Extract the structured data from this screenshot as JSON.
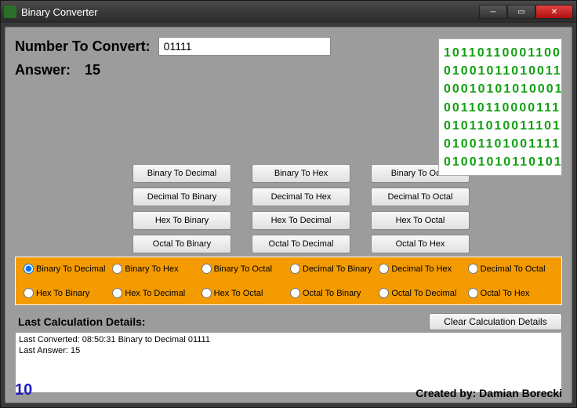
{
  "window": {
    "title": "Binary Converter"
  },
  "input": {
    "label": "Number To Convert:",
    "value": "01111"
  },
  "answer": {
    "label": "Answer:",
    "value": "15"
  },
  "buttons": [
    "Binary To Decimal",
    "Binary To Hex",
    "Binary To Octal",
    "Decimal To Binary",
    "Decimal To Hex",
    "Decimal To Octal",
    "Hex To Binary",
    "Hex To Decimal",
    "Hex To Octal",
    "Octal To Binary",
    "Octal To Decimal",
    "Octal To Hex"
  ],
  "radios": [
    "Binary To Decimal",
    "Binary To Hex",
    "Binary To Octal",
    "Decimal To Binary",
    "Decimal To Hex",
    "Decimal To Octal",
    "Hex To Binary",
    "Hex To Decimal",
    "Hex To Octal",
    "Octal To Binary",
    "Octal To Decimal",
    "Octal To Hex"
  ],
  "radio_selected_index": 0,
  "binary_art": [
    "10110110001100",
    "01001011010011",
    "00010101010001",
    "00110110000111",
    "01011010011101",
    "01001101001111",
    "01001010110101"
  ],
  "details": {
    "header": "Last Calculation Details:",
    "line1": "Last Converted: 08:50:31  Binary to Decimal 01111",
    "line2": "Last Answer: 15",
    "clear_label": "Clear Calculation Details"
  },
  "footer": {
    "count": "10",
    "credit": "Created by: Damian Borecki"
  }
}
